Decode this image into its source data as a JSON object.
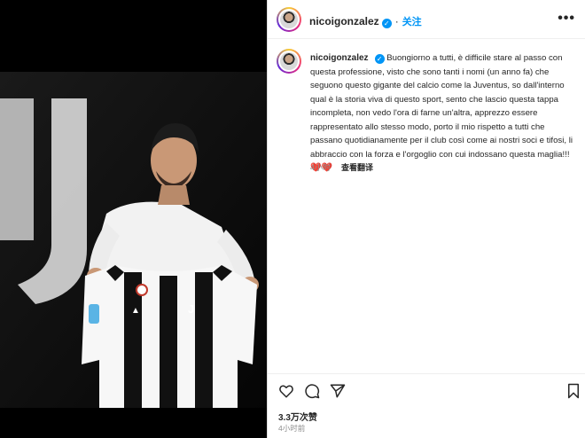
{
  "post": {
    "username": "nicoigonzalez",
    "follow_label": "关注",
    "more_label": "•••",
    "caption_text": "Buongiorno a tutti, è difficile stare al passo con questa professione, visto che sono tanti i nomi (un anno fa) che seguono questo gigante del calcio come la Juventus, so dall'interno qual è la storia viva di questo sport, sento che lascio questa tappa incompleta, non vedo l'ora di farne un'altra, apprezzo essere rappresentato allo stesso modo, porto il mio rispetto a tutti che passano quotidianamente per il club così come ai nostri soci e tifosi, li abbraccio con la forza e l'orgoglio con cui indossano questa maglia!!!",
    "caption_emoji": "❤️❤️",
    "caption_time": "4小时",
    "translate_label": "查看翻译",
    "likes": "3.3万次赞",
    "posted_ago": "4小时前"
  },
  "colors": {
    "accent": "#0095f6",
    "heart": "#ed4956"
  }
}
